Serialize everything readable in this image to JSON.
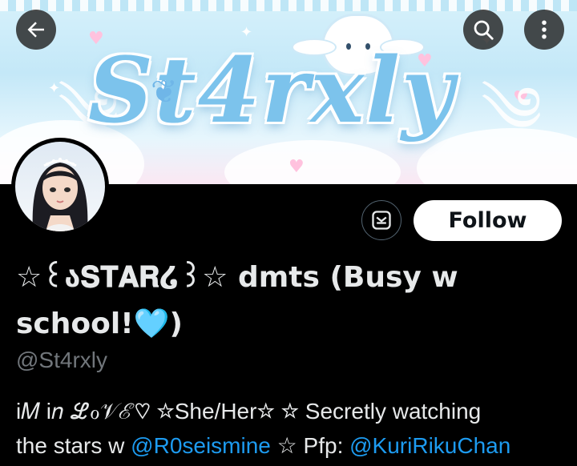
{
  "banner": {
    "title_text": "St4rxly",
    "colors": {
      "primary": "#7cc3ec",
      "sky": "#d6f1fb",
      "pink": "#ffc2de"
    }
  },
  "header": {
    "back_icon": "arrow-left-icon",
    "search_icon": "search-icon",
    "more_icon": "more-vertical-icon"
  },
  "profile": {
    "display_name": "☆꒰ა𝐒𝐓𝐀𝐑໒꒱☆ dmts (Busy w school!🩵)",
    "handle": "@St4rxly",
    "bio": {
      "part1": "i𝑀 i𝑛 ℒℴ𝒱ℰ♡  ☆She/Her☆   ☆ Secretly watching",
      "part2_prefix": "the stars w ",
      "mention1": "@R0seismine",
      "part2_middle": " ☆  Pfp: ",
      "mention2": "@KuriRikuChan"
    }
  },
  "actions": {
    "message_icon": "mail-icon",
    "follow_label": "Follow"
  },
  "colors": {
    "accent": "#1d9bf0",
    "secondary_text": "#71767b",
    "text": "#e7e9ea",
    "background": "#000000"
  }
}
